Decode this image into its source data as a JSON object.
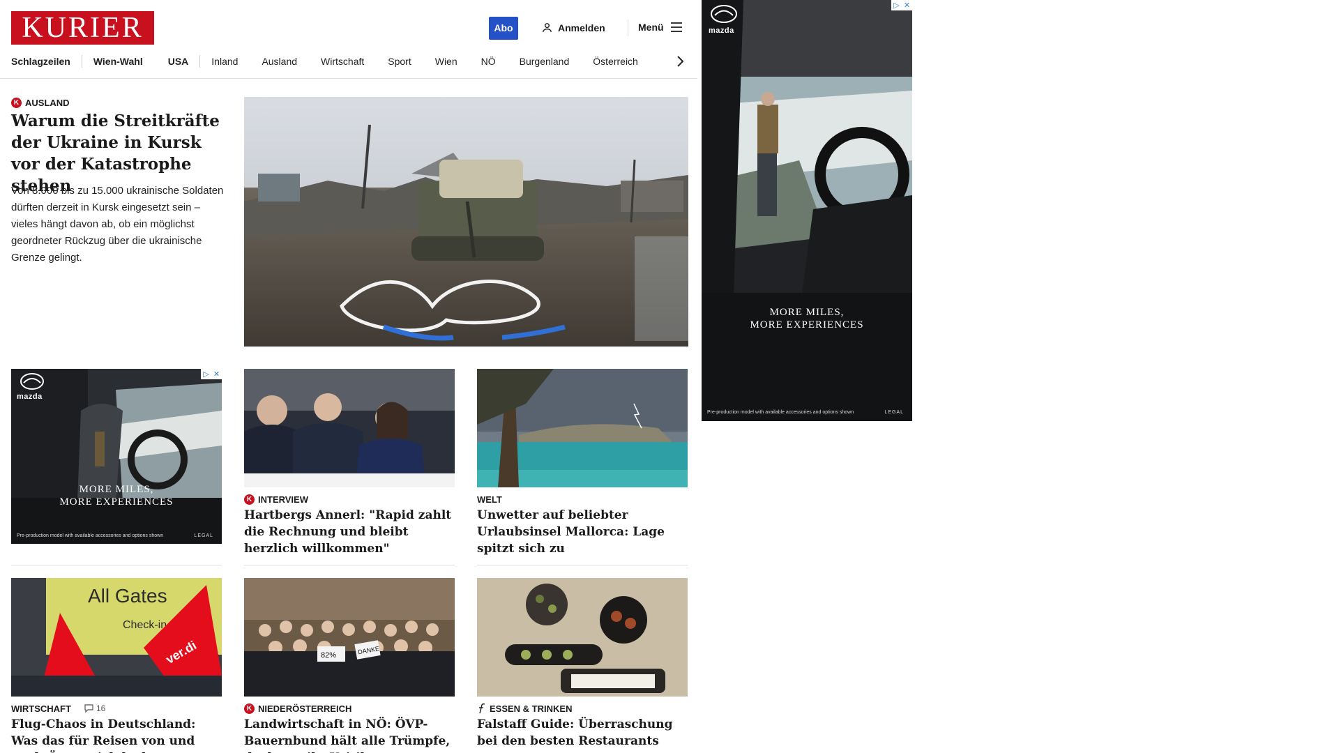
{
  "header": {
    "logo": "KURIER",
    "abo_label": "Abo",
    "login_label": "Anmelden",
    "menu_label": "Menü"
  },
  "nav": {
    "items": [
      "Schlagzeilen",
      "Wien-Wahl",
      "USA",
      "Inland",
      "Ausland",
      "Wirtschaft",
      "Sport",
      "Wien",
      "NÖ",
      "Burgenland",
      "Österreich"
    ]
  },
  "top_story": {
    "kicker": "AUSLAND",
    "title": "Warum die Streitkräfte der Ukraine in Kursk vor der Katastrophe stehen",
    "teaser": "Von 8.000 bis zu 15.000 ukrainische Soldaten dürften derzeit in Kursk eingesetzt sein – vieles hängt davon ab, ob ein möglichst geordneter Rückzug über die ukrainische Grenze gelingt."
  },
  "ads": {
    "brand": "mazda",
    "tagline_1": "MORE MILES,",
    "tagline_2": "MORE EXPERIENCES",
    "disclaimer": "Pre-production model with available accessories and options shown",
    "legal": "LEGAL",
    "flag_info": "▷",
    "flag_close": "✕"
  },
  "cards": [
    {
      "kicker": "INTERVIEW",
      "title": "Hartbergs Annerl: \"Rapid zahlt die Rechnung und bleibt herzlich willkommen\""
    },
    {
      "kicker": "WELT",
      "title": "Unwetter auf beliebter Urlaubsinsel Mallorca: Lage spitzt sich zu"
    },
    {
      "kicker": "WIRTSCHAFT",
      "comments": "16",
      "title": "Flug-Chaos in Deutschland: Was das für Reisen von und nach Österreich bedeutet"
    },
    {
      "kicker": "NIEDERÖSTERREICH",
      "title": "Landwirtschaft in NÖ: ÖVP-Bauernbund hält alle Trümpfe, doch es gibt Kritik"
    },
    {
      "kicker": "ESSEN & TRINKEN",
      "title": "Falstaff Guide: Überraschung bei den besten Restaurants"
    }
  ],
  "photo_text": {
    "airport_sign": "All Gates",
    "airport_checkin": "Check-in",
    "banner": "ver.di",
    "crowd_sign_1": "82%",
    "crowd_sign_2": "DANKE"
  }
}
